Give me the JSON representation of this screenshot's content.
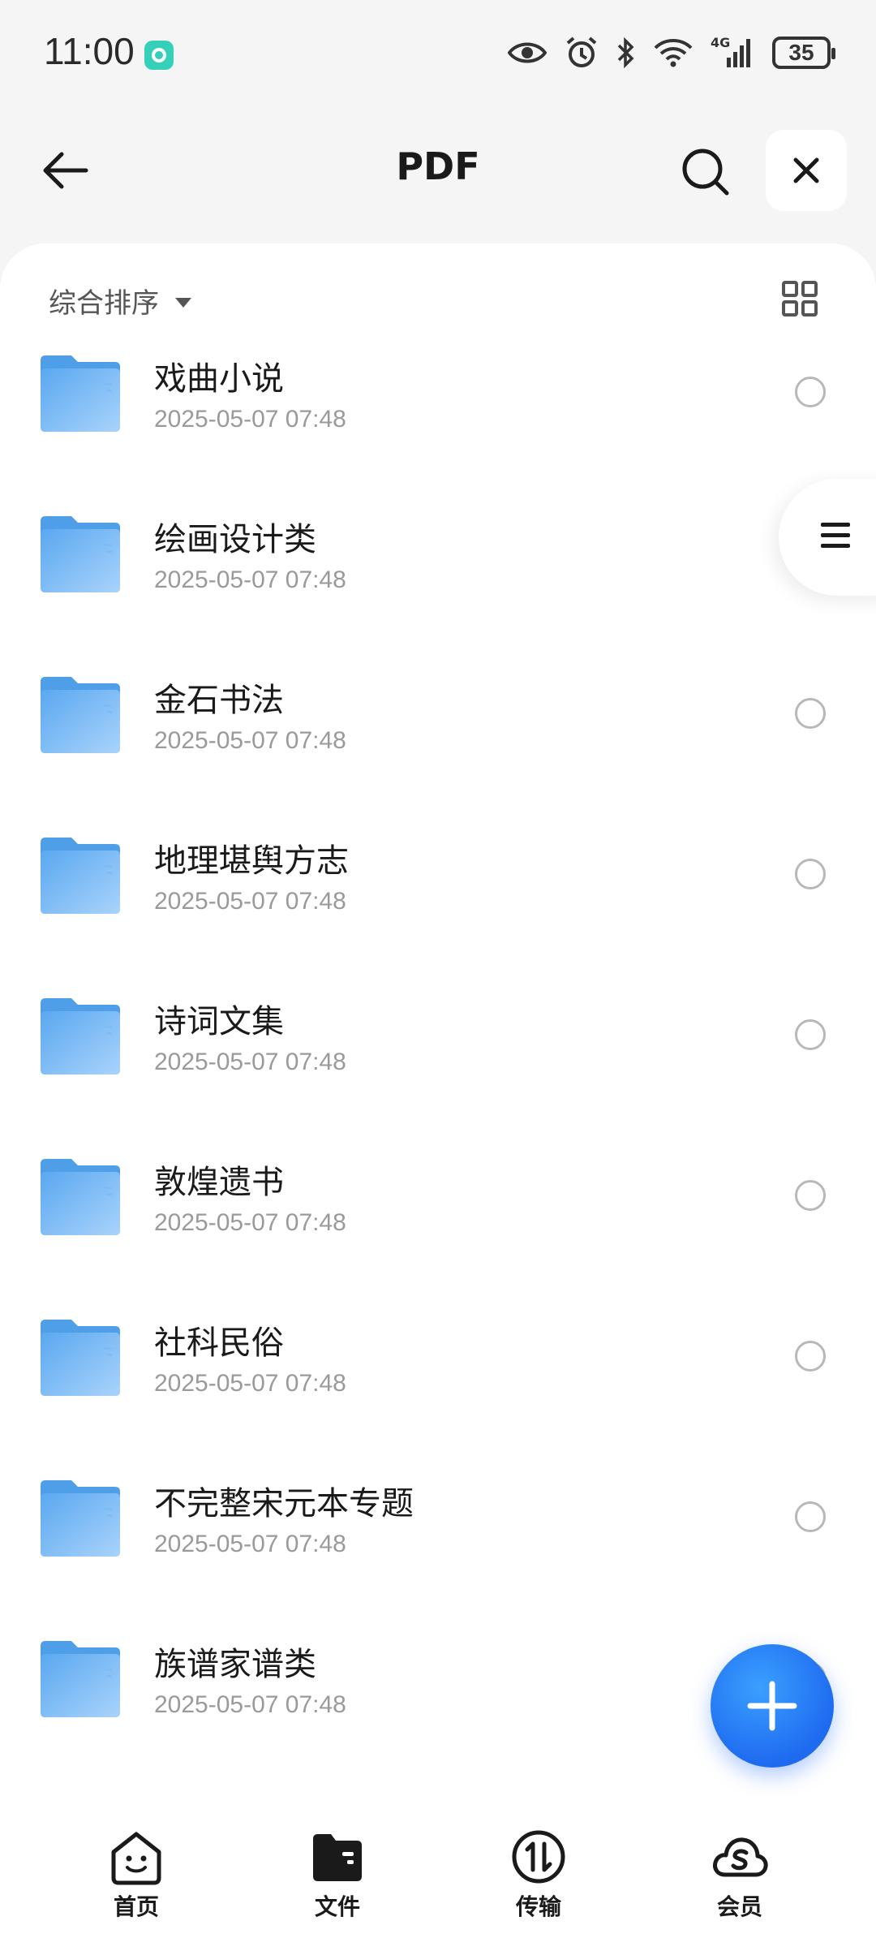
{
  "status_bar": {
    "time": "11:00",
    "network": "4G",
    "battery": "35"
  },
  "header": {
    "title": "PDF"
  },
  "toolbar": {
    "sort_label": "综合排序"
  },
  "files": [
    {
      "name": "戏曲小说",
      "date": "2025-05-07 07:48"
    },
    {
      "name": "绘画设计类",
      "date": "2025-05-07 07:48"
    },
    {
      "name": "金石书法",
      "date": "2025-05-07 07:48"
    },
    {
      "name": "地理堪舆方志",
      "date": "2025-05-07 07:48"
    },
    {
      "name": "诗词文集",
      "date": "2025-05-07 07:48"
    },
    {
      "name": "敦煌遗书",
      "date": "2025-05-07 07:48"
    },
    {
      "name": "社科民俗",
      "date": "2025-05-07 07:48"
    },
    {
      "name": "不完整宋元本专题",
      "date": "2025-05-07 07:48"
    },
    {
      "name": "族谱家谱类",
      "date": "2025-05-07 07:48"
    }
  ],
  "bottom_nav": [
    {
      "label": "首页",
      "icon": "home-face-icon"
    },
    {
      "label": "文件",
      "icon": "folder-icon"
    },
    {
      "label": "传输",
      "icon": "transfer-icon"
    },
    {
      "label": "会员",
      "icon": "vip-cloud-icon"
    }
  ],
  "colors": {
    "accent": "#1f6bf0",
    "folder": "#6fb4f2",
    "background": "#f5f5f5"
  }
}
